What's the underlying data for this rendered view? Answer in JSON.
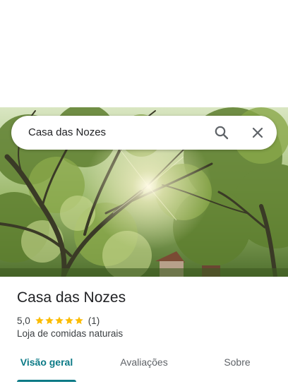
{
  "search": {
    "query": "Casa das Nozes",
    "search_icon": "search-icon",
    "close_icon": "close-icon"
  },
  "hero": {
    "description_icon": "place-photo"
  },
  "place": {
    "name": "Casa das Nozes",
    "rating": "5,0",
    "stars": 5,
    "review_count": "(1)",
    "category": "Loja de comidas naturais"
  },
  "tabs": [
    {
      "label": "Visão geral",
      "active": true
    },
    {
      "label": "Avaliações",
      "active": false
    },
    {
      "label": "Sobre",
      "active": false
    }
  ],
  "colors": {
    "accent": "#0b7a86",
    "star": "#fbbc04",
    "text_primary": "#202124",
    "text_secondary": "#3c4043"
  }
}
